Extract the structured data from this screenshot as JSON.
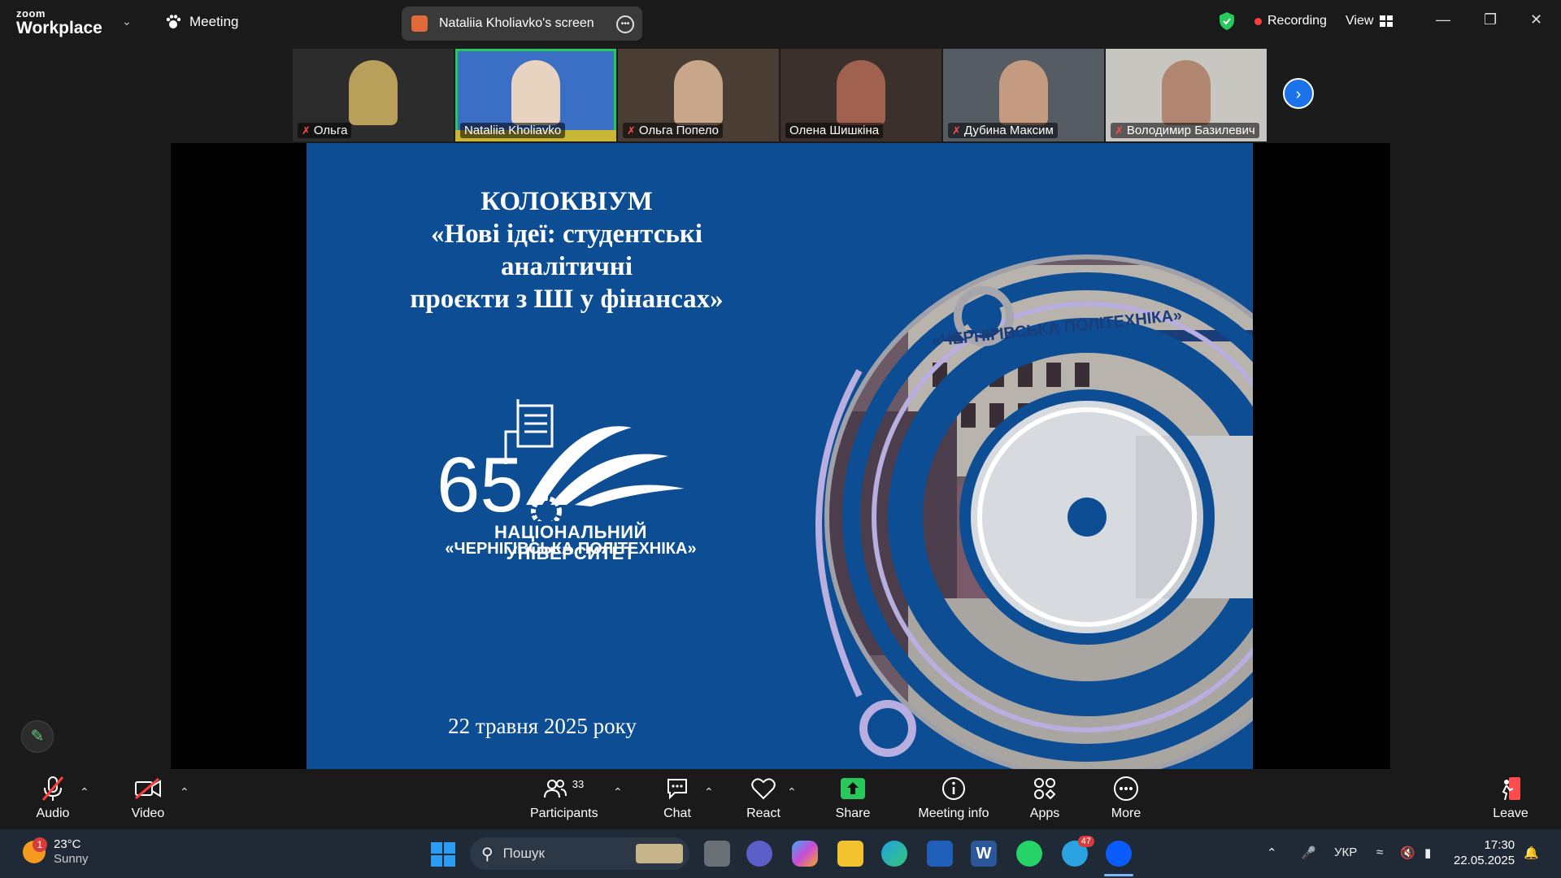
{
  "titlebar": {
    "logo_top": "zoom",
    "logo_bottom": "Workplace",
    "meeting_label": "Meeting",
    "screen_pill": "Nataliia Kholiavko's screen",
    "recording": "Recording",
    "view": "View"
  },
  "participants": [
    {
      "name": "Ольга",
      "muted": true,
      "color": "#6b5a3a"
    },
    {
      "name": "Nataliia Kholiavko",
      "muted": false,
      "color": "#3b6fc6",
      "active": true
    },
    {
      "name": "Ольга Попело",
      "muted": true,
      "color": "#5c4a3c"
    },
    {
      "name": "Олена Шишкіна",
      "muted": false,
      "color": "#4a3a34"
    },
    {
      "name": "Дубина Максим",
      "muted": true,
      "color": "#4e5660"
    },
    {
      "name": "Володимир Базилевич",
      "muted": true,
      "color": "#9a9a96"
    }
  ],
  "slide": {
    "title_line1": "КОЛОКВІУМ",
    "title_line2": "«Нові ідеї: студентські аналітичні",
    "title_line3": "проєкти з ШІ у фінансах»",
    "logo_number": "65",
    "uni_line1": "НАЦІОНАЛЬНИЙ УНІВЕРСИТЕТ",
    "uni_line2": "«ЧЕРНІГІВСЬКА ПОЛІТЕХНІКА»",
    "building_sign": "«ЧЕРНІГІВСЬКА ПОЛІТЕХНІКА»",
    "date": "22 травня 2025 року"
  },
  "toolbar": {
    "audio": "Audio",
    "video": "Video",
    "participants": "Participants",
    "participants_count": "33",
    "chat": "Chat",
    "react": "React",
    "share": "Share",
    "meeting_info": "Meeting info",
    "apps": "Apps",
    "more": "More",
    "leave": "Leave"
  },
  "taskbar": {
    "weather_temp": "23°C",
    "weather_cond": "Sunny",
    "weather_badge": "1",
    "search_placeholder": "Пошук",
    "telegram_badge": "47",
    "lang": "УКР",
    "time": "17:30",
    "date": "22.05.2025"
  },
  "colors": {
    "accent_green": "#27c95a",
    "slide_blue": "#0c4d93",
    "recording_red": "#ff3b3b"
  }
}
